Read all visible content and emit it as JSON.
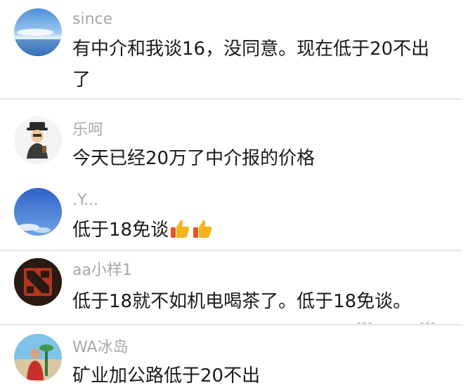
{
  "comments": [
    {
      "username": "since",
      "text": "有中介和我谈16，没同意。现在低于20不出了",
      "avatar": "sky-sea-photo-avatar"
    },
    {
      "username": "乐呵",
      "text": "今天已经20万了中介报的价格",
      "avatar": "cartoon-man-avatar"
    },
    {
      "username": ".Y...",
      "text": "低于18免谈",
      "avatar": "blue-sky-avatar",
      "emojis": [
        "thumbs-up-icon",
        "thumbs-up-icon"
      ]
    },
    {
      "username": "aa小样1",
      "text": "低于18就不如机电喝茶了。低于18免谈。",
      "avatar": "dota-logo-avatar"
    },
    {
      "username": "WA冰岛",
      "text": "矿业加公路低于20不出",
      "avatar": "beach-person-avatar"
    }
  ],
  "colors": {
    "username": "#a8a8a8",
    "text": "#1a1a1a",
    "divider": "#e6e6e6",
    "thumb": "#f6b31b"
  }
}
